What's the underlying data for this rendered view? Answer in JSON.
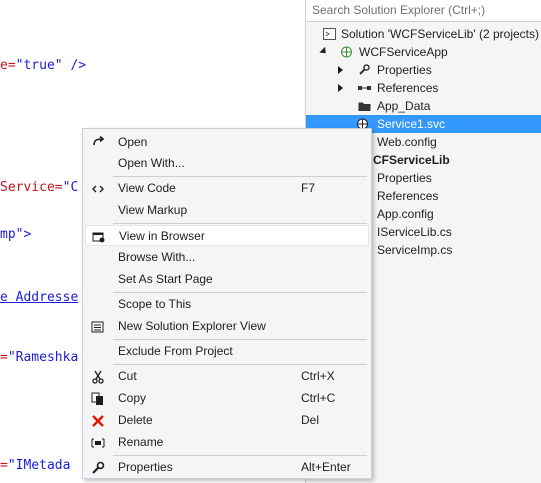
{
  "code": {
    "lines": [
      {
        "prefix": "e=",
        "value": "\"true\"",
        "suffix": " />"
      },
      {
        "red": "Service=",
        "value": "\"C"
      },
      {
        "plain": "mp\">"
      },
      {
        "link": "e Addresse"
      },
      {
        "prefix": "=",
        "value": "\"Rameshka"
      },
      {
        "prefix": "=",
        "value": "\"IMetada"
      }
    ]
  },
  "solution_explorer": {
    "search_placeholder": "Search Solution Explorer (Ctrl+;)",
    "items": [
      {
        "label": "Solution 'WCFServiceLib' (2 projects)",
        "icon": "solution-icon"
      },
      {
        "label": "WCFServiceApp",
        "icon": "web-project-icon"
      },
      {
        "label": "Properties",
        "icon": "wrench-icon"
      },
      {
        "label": "References",
        "icon": "references-icon"
      },
      {
        "label": "App_Data",
        "icon": "folder-icon"
      },
      {
        "label": "Service1.svc",
        "icon": "service-icon"
      },
      {
        "label": "Web.config",
        "icon": "config-icon"
      },
      {
        "label": "CFServiceLib",
        "icon": "project-icon"
      },
      {
        "label": "Properties",
        "icon": "wrench-icon"
      },
      {
        "label": "References",
        "icon": "references-icon"
      },
      {
        "label": "App.config",
        "icon": "config-icon"
      },
      {
        "label": "IServiceLib.cs",
        "icon": "cs-file-icon"
      },
      {
        "label": "ServiceImp.cs",
        "icon": "cs-file-icon"
      }
    ]
  },
  "context_menu": {
    "items": [
      {
        "label": "Open",
        "icon": "open-icon",
        "shortcut": ""
      },
      {
        "label": "Open With...",
        "icon": "",
        "shortcut": ""
      },
      {
        "label": "View Code",
        "icon": "code-icon",
        "shortcut": "F7"
      },
      {
        "label": "View Markup",
        "icon": "",
        "shortcut": ""
      },
      {
        "label": "View in Browser",
        "icon": "browser-icon",
        "shortcut": ""
      },
      {
        "label": "Browse With...",
        "icon": "",
        "shortcut": ""
      },
      {
        "label": "Set As Start Page",
        "icon": "",
        "shortcut": ""
      },
      {
        "label": "Scope to This",
        "icon": "",
        "shortcut": ""
      },
      {
        "label": "New Solution Explorer View",
        "icon": "new-view-icon",
        "shortcut": ""
      },
      {
        "label": "Exclude From Project",
        "icon": "",
        "shortcut": ""
      },
      {
        "label": "Cut",
        "icon": "scissors-icon",
        "shortcut": "Ctrl+X"
      },
      {
        "label": "Copy",
        "icon": "copy-icon",
        "shortcut": "Ctrl+C"
      },
      {
        "label": "Delete",
        "icon": "delete-icon",
        "shortcut": "Del"
      },
      {
        "label": "Rename",
        "icon": "rename-icon",
        "shortcut": ""
      },
      {
        "label": "Properties",
        "icon": "wrench-icon",
        "shortcut": "Alt+Enter"
      }
    ]
  },
  "colors": {
    "selection": "#3399ff",
    "delete_icon": "#e51400",
    "code_red": "#c4141f",
    "code_blue": "#1c1cd6"
  }
}
